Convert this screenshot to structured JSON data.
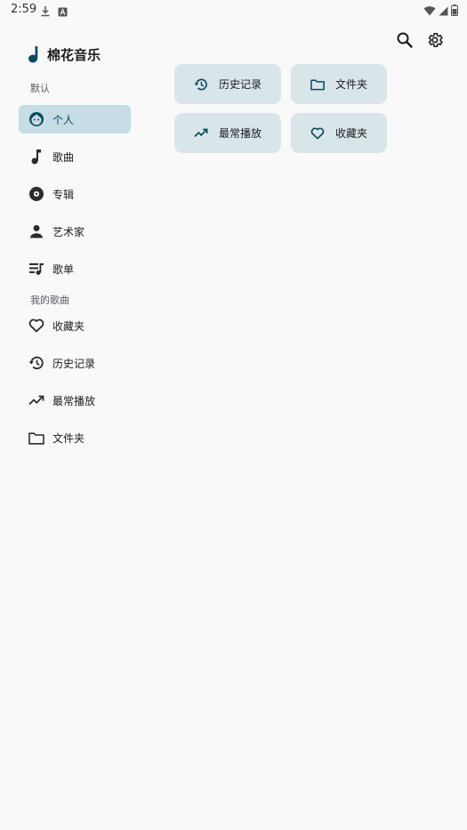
{
  "status_bar": {
    "time": "2:59",
    "icons": [
      "download-icon",
      "keyboard-icon",
      "wifi-icon",
      "signal-icon",
      "battery-icon"
    ]
  },
  "app": {
    "title": "棉花音乐",
    "accent_color": "#0d4a60",
    "selected_bg": "#c7dde5",
    "card_bg": "#d8e6ea"
  },
  "top_actions": {
    "icons": [
      "search-icon",
      "settings-icon"
    ]
  },
  "sidebar": {
    "section_default": "默认",
    "default_items": [
      {
        "label": "个人",
        "icon": "face-icon",
        "selected": true
      },
      {
        "label": "歌曲",
        "icon": "music-note-icon",
        "selected": false
      },
      {
        "label": "专辑",
        "icon": "album-icon",
        "selected": false
      },
      {
        "label": "艺术家",
        "icon": "person-icon",
        "selected": false
      },
      {
        "label": "歌单",
        "icon": "playlist-icon",
        "selected": false
      }
    ],
    "section_mine": "我的歌曲",
    "mine_items": [
      {
        "label": "收藏夹",
        "icon": "heart-icon"
      },
      {
        "label": "历史记录",
        "icon": "history-icon"
      },
      {
        "label": "最常播放",
        "icon": "trending-up-icon"
      },
      {
        "label": "文件夹",
        "icon": "folder-icon"
      }
    ]
  },
  "cards": [
    {
      "label": "历史记录",
      "icon": "history-icon"
    },
    {
      "label": "文件夹",
      "icon": "folder-icon"
    },
    {
      "label": "最常播放",
      "icon": "trending-up-icon"
    },
    {
      "label": "收藏夹",
      "icon": "heart-icon"
    }
  ]
}
